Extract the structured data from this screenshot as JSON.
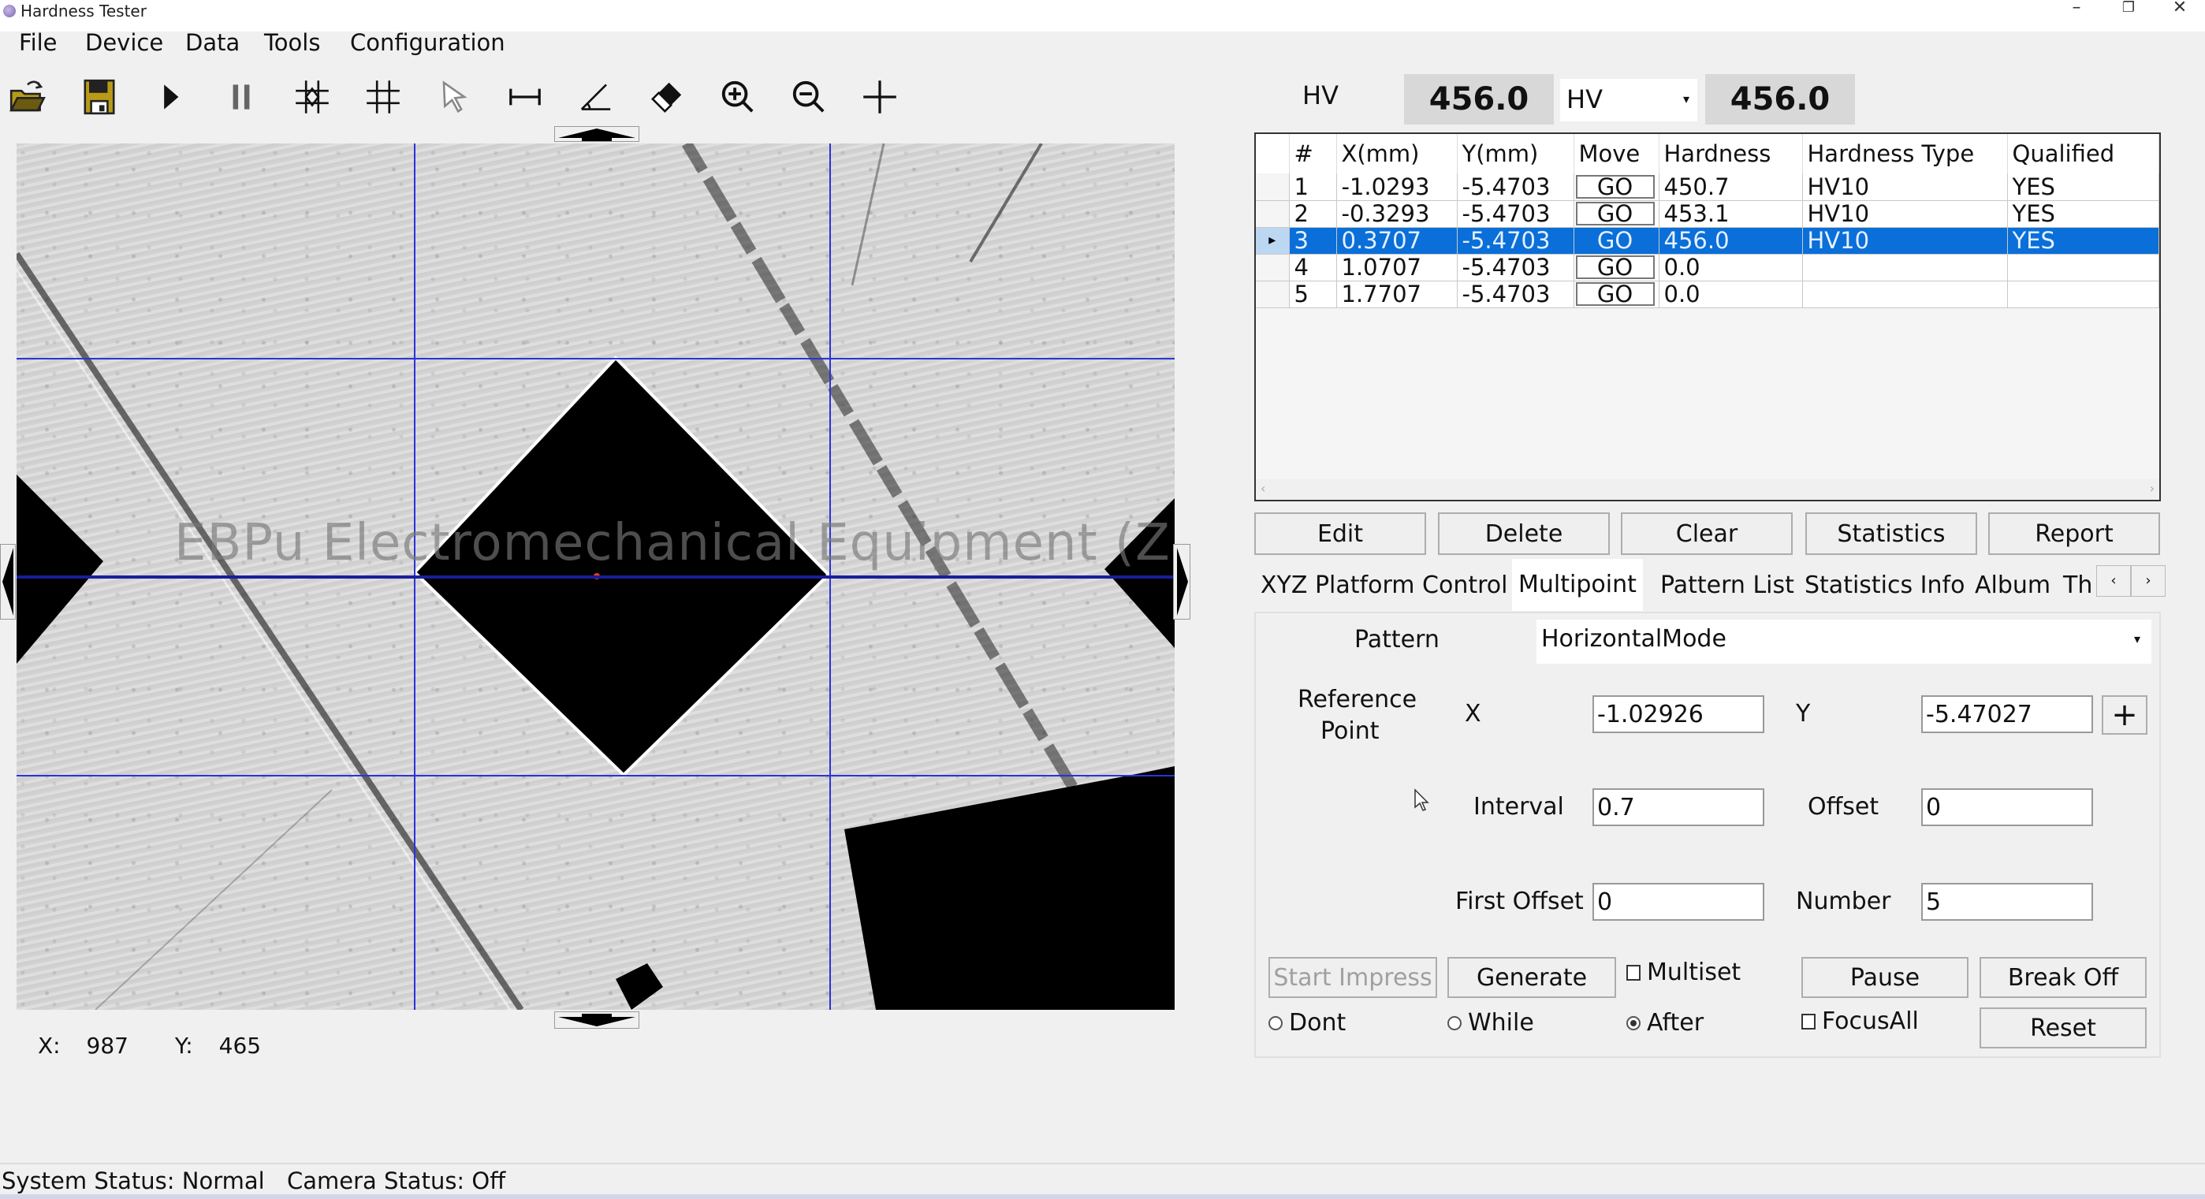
{
  "window": {
    "title": "Hardness Tester",
    "controls": {
      "minimize": "–",
      "restore": "❐",
      "close": "✕"
    }
  },
  "menu": [
    "File",
    "Device",
    "Data",
    "Tools",
    "Configuration"
  ],
  "toolbar": [
    {
      "icon": "open-folder-icon"
    },
    {
      "icon": "save-icon"
    },
    {
      "icon": "play-icon"
    },
    {
      "icon": "pause-icon"
    },
    {
      "icon": "auto-measure-icon"
    },
    {
      "icon": "grid-icon"
    },
    {
      "icon": "pointer-icon"
    },
    {
      "icon": "distance-icon"
    },
    {
      "icon": "angle-icon"
    },
    {
      "icon": "eraser-icon"
    },
    {
      "icon": "zoom-in-icon"
    },
    {
      "icon": "zoom-out-icon"
    },
    {
      "icon": "crosshair-icon"
    }
  ],
  "viewer": {
    "watermark": "EBPu Electromechanical Equipment (Zhejiang) Co., Ltd."
  },
  "cursor_readout": {
    "x_label": "X:",
    "x_value": "987",
    "y_label": "Y:",
    "y_value": "465"
  },
  "hardness_display": {
    "unit_label": "HV",
    "value": "456.0",
    "convert_unit": "HV",
    "converted_value": "456.0"
  },
  "table": {
    "columns": [
      "#",
      "X(mm)",
      "Y(mm)",
      "Move",
      "Hardness",
      "Hardness Type",
      "Qualified"
    ],
    "selected_row": 3,
    "rows": [
      {
        "n": "1",
        "x": "-1.0293",
        "y": "-5.4703",
        "move": "GO",
        "hardness": "450.7",
        "type": "HV10",
        "qualified": "YES"
      },
      {
        "n": "2",
        "x": "-0.3293",
        "y": "-5.4703",
        "move": "GO",
        "hardness": "453.1",
        "type": "HV10",
        "qualified": "YES"
      },
      {
        "n": "3",
        "x": "0.3707",
        "y": "-5.4703",
        "move": "GO",
        "hardness": "456.0",
        "type": "HV10",
        "qualified": "YES"
      },
      {
        "n": "4",
        "x": "1.0707",
        "y": "-5.4703",
        "move": "GO",
        "hardness": "0.0",
        "type": "",
        "qualified": ""
      },
      {
        "n": "5",
        "x": "1.7707",
        "y": "-5.4703",
        "move": "GO",
        "hardness": "0.0",
        "type": "",
        "qualified": ""
      }
    ]
  },
  "table_actions": [
    "Edit",
    "Delete",
    "Clear",
    "Statistics",
    "Report"
  ],
  "tabs": {
    "items": [
      "XYZ Platform Control",
      "Multipoint",
      "Pattern List",
      "Statistics Info",
      "Album",
      "Th"
    ],
    "active": "Multipoint",
    "scroll_left": "‹",
    "scroll_right": "›"
  },
  "multipoint": {
    "pattern_label": "Pattern",
    "pattern_value": "HorizontalMode",
    "ref_label_1": "Reference",
    "ref_label_2": "Point",
    "x_label": "X",
    "x_value": "-1.02926",
    "y_label": "Y",
    "y_value": "-5.47027",
    "add_button": "+",
    "interval_label": "Interval",
    "interval_value": "0.7",
    "offset_label": "Offset",
    "offset_value": "0",
    "first_offset_label": "First Offset",
    "first_offset_value": "0",
    "number_label": "Number",
    "number_value": "5",
    "start_impress": "Start Impress",
    "generate": "Generate",
    "multiset_label": "Multiset",
    "multiset_checked": false,
    "pause": "Pause",
    "break_off": "Break Off",
    "focus_mode": {
      "options": [
        "Dont",
        "While",
        "After"
      ],
      "selected": "After"
    },
    "focus_all_label": "FocusAll",
    "focus_all_checked": false,
    "reset": "Reset"
  },
  "status": {
    "system": "System Status: Normal",
    "camera": "Camera Status: Off"
  },
  "colors": {
    "selection": "#0a6fd8",
    "guide_lines": "#2b33d6",
    "center_dot": "#ff3b1f"
  }
}
